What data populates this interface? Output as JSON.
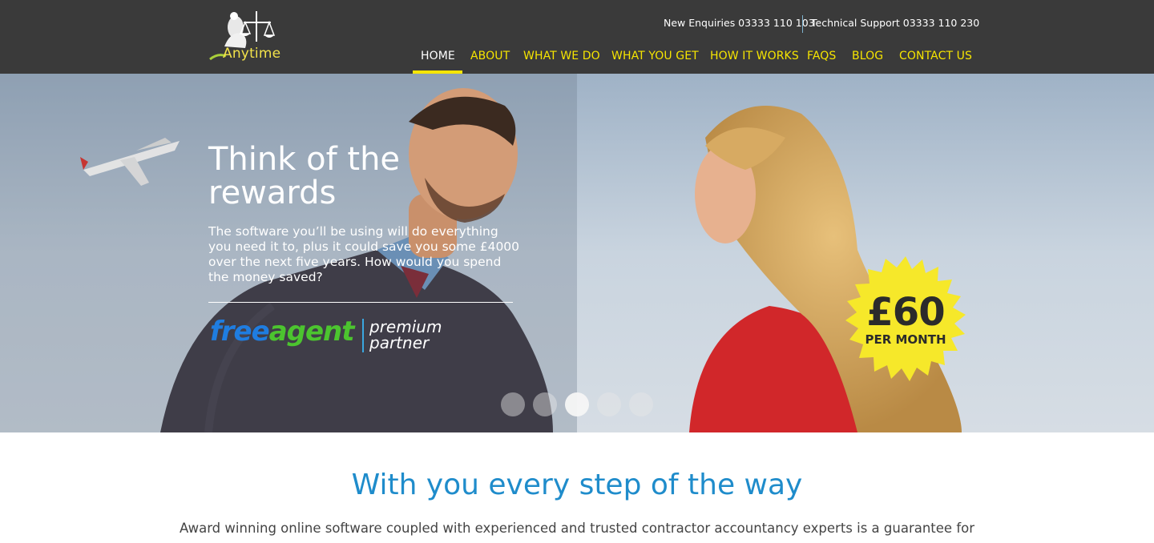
{
  "header": {
    "logo_text": "Anytime",
    "contact_new": "New Enquiries 03333 110 103",
    "contact_support": "Technical Support 03333 110 230",
    "nav": [
      {
        "label": "HOME",
        "active": true
      },
      {
        "label": "ABOUT",
        "active": false
      },
      {
        "label": "WHAT WE DO",
        "active": false
      },
      {
        "label": "WHAT YOU GET",
        "active": false
      },
      {
        "label": "HOW IT WORKS",
        "active": false
      },
      {
        "label": "FAQS",
        "active": false
      },
      {
        "label": "BLOG",
        "active": false
      },
      {
        "label": "CONTACT US",
        "active": false
      }
    ]
  },
  "hero": {
    "title": "Think of the rewards",
    "body": "The software you’ll be using will do everything you need it to, plus it could save you some £4000 over the next five years. How would you spend the money saved?",
    "partner_free": "free",
    "partner_agent": "agent",
    "partner_premium": "premium",
    "partner_partner": "partner",
    "badge_price": "£60",
    "badge_sub": "PER MONTH",
    "slides_total": 5,
    "slide_active_index": 3
  },
  "intro": {
    "title": "With you every step of the way",
    "text": "Award winning online software coupled with experienced and trusted contractor accountancy experts is a guarantee for"
  },
  "colors": {
    "header_bg": "#3a3a3a",
    "nav_yellow": "#f6e500",
    "accent_blue": "#1f8ccb",
    "badge_yellow": "#f6e82a"
  }
}
